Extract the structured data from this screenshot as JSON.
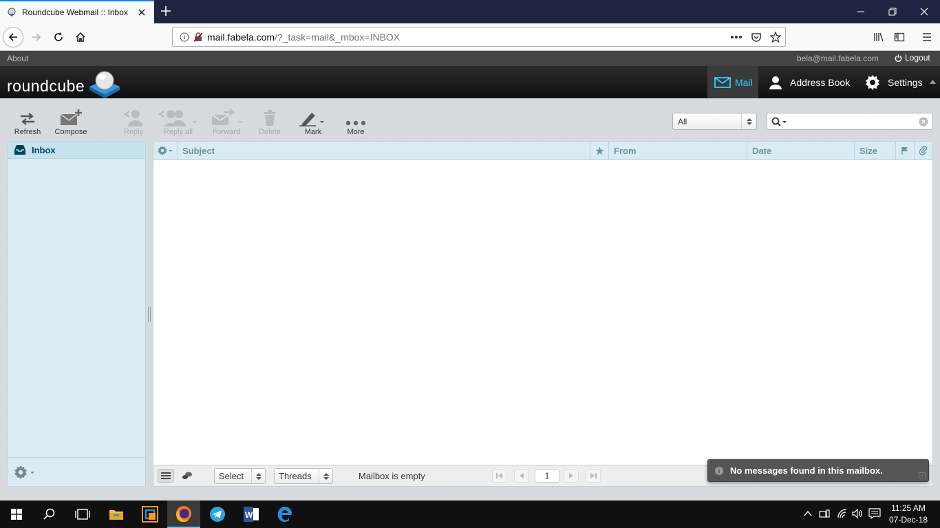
{
  "browser": {
    "tab_title": "Roundcube Webmail :: Inbox",
    "url_domain": "mail.fabela.com",
    "url_rest": "/?_task=mail&_mbox=INBOX"
  },
  "topline": {
    "about": "About",
    "user": "bela@mail.fabela.com",
    "logout": "Logout"
  },
  "logo": {
    "text": "roundcube"
  },
  "tasks": {
    "mail": "Mail",
    "addressbook": "Address Book",
    "settings": "Settings"
  },
  "toolbar": {
    "refresh": "Refresh",
    "compose": "Compose",
    "reply": "Reply",
    "reply_all": "Reply all",
    "forward": "Forward",
    "delete": "Delete",
    "mark": "Mark",
    "more": "More"
  },
  "filter": {
    "selected": "All"
  },
  "folders": [
    {
      "name": "Inbox"
    }
  ],
  "list_columns": {
    "subject": "Subject",
    "from": "From",
    "date": "Date",
    "size": "Size"
  },
  "list_footer": {
    "select": "Select",
    "threads": "Threads",
    "status": "Mailbox is empty",
    "page": "1"
  },
  "toast": {
    "message": "No messages found in this mailbox."
  },
  "taskbar": {
    "time": "11:25 AM",
    "date": "07-Dec-18"
  },
  "colors": {
    "accent": "#33ccff",
    "header": "#1a1a1a",
    "panel": "#d9ecf4"
  }
}
